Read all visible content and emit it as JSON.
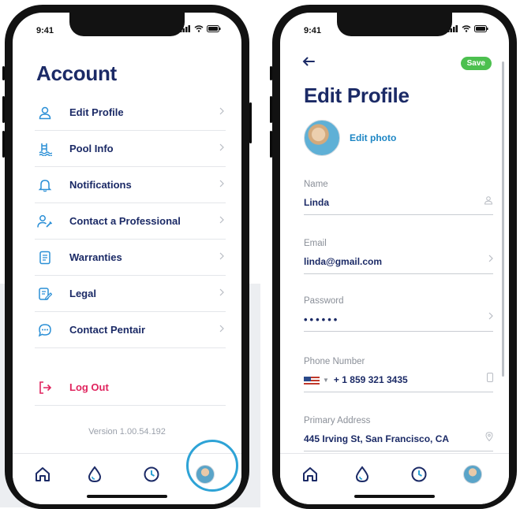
{
  "status_bar": {
    "time": "9:41"
  },
  "account_screen": {
    "title": "Account",
    "menu_items": [
      {
        "label": "Edit Profile",
        "icon": "user-icon"
      },
      {
        "label": "Pool Info",
        "icon": "pool-ladder-icon"
      },
      {
        "label": "Notifications",
        "icon": "bell-icon"
      },
      {
        "label": "Contact a Professional",
        "icon": "professional-icon"
      },
      {
        "label": "Warranties",
        "icon": "document-icon"
      },
      {
        "label": "Legal",
        "icon": "edit-document-icon"
      },
      {
        "label": "Contact Pentair",
        "icon": "chat-bubble-icon"
      }
    ],
    "logout_label": "Log Out",
    "version": "Version 1.00.54.192"
  },
  "edit_profile_screen": {
    "title": "Edit Profile",
    "save_label": "Save",
    "edit_photo_label": "Edit photo",
    "fields": [
      {
        "label": "Name",
        "value": "Linda",
        "icon": "user-icon"
      },
      {
        "label": "Email",
        "value": "linda@gmail.com",
        "icon": "chevron-right-icon"
      },
      {
        "label": "Password",
        "value": "••••••",
        "icon": "chevron-right-icon"
      },
      {
        "label": "Phone Number",
        "value": "+ 1 859 321 3435",
        "icon": "phone-icon"
      },
      {
        "label": "Primary Address",
        "value": "445 Irving St, San Francisco, CA",
        "icon": "location-pin-icon"
      }
    ]
  },
  "tab_bar": {
    "tabs": [
      "home-icon",
      "water-drop-icon",
      "clock-icon",
      "profile-avatar"
    ]
  },
  "colors": {
    "navy": "#1b2a66",
    "accent_blue": "#2ea3d6",
    "logout_red": "#e0245e",
    "save_green": "#4cc04f"
  }
}
